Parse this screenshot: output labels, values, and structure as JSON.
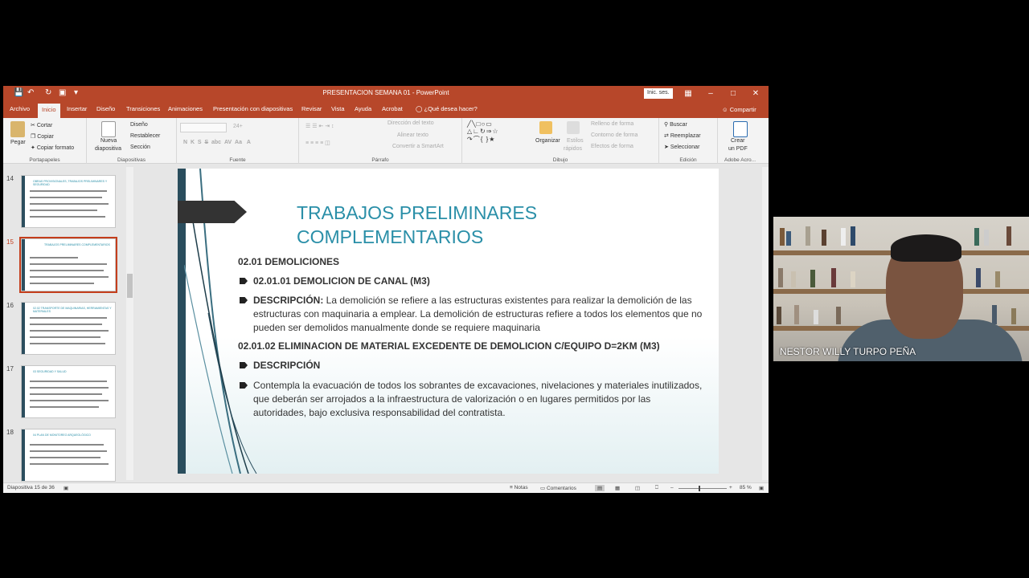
{
  "window": {
    "title": "PRESENTACION SEMANA 01  -  PowerPoint",
    "sign_in": "Inic. ses.",
    "controls": {
      "minimize": "–",
      "maximize": "□",
      "close": "✕"
    }
  },
  "tabs": [
    "Archivo",
    "Inicio",
    "Insertar",
    "Diseño",
    "Transiciones",
    "Animaciones",
    "Presentación con diapositivas",
    "Revisar",
    "Vista",
    "Ayuda",
    "Acrobat"
  ],
  "active_tab": "Inicio",
  "tell_me": "¿Qué desea hacer?",
  "share": "Compartir",
  "ribbon": {
    "clipboard": {
      "paste": "Pegar",
      "cut": "Cortar",
      "copy": "Copiar",
      "format_painter": "Copiar formato",
      "label": "Portapapeles"
    },
    "slides": {
      "new_slide_1": "Nueva",
      "new_slide_2": "diapositiva",
      "layout": "Diseño",
      "reset": "Restablecer",
      "section": "Sección",
      "label": "Diapositivas"
    },
    "font": {
      "size": "24+",
      "label": "Fuente"
    },
    "paragraph": {
      "text_direction": "Dirección del texto",
      "align_text": "Alinear texto",
      "smartart": "Convertir a SmartArt",
      "label": "Párrafo"
    },
    "drawing": {
      "arrange": "Organizar",
      "quick_styles_1": "Estilos",
      "quick_styles_2": "rápidos",
      "fill": "Relleno de forma",
      "outline": "Contorno de forma",
      "effects": "Efectos de forma",
      "label": "Dibujo"
    },
    "editing": {
      "find": "Buscar",
      "replace": "Reemplazar",
      "select": "Seleccionar",
      "label": "Edición"
    },
    "acrobat": {
      "create_pdf_1": "Crear",
      "create_pdf_2": "un PDF",
      "label": "Adobe Acro..."
    }
  },
  "thumbnails": [
    {
      "number": "14",
      "title": "OBRAS PROVISIONALES, TRABAJOS PRELIMINARES Y SEGURIDAD",
      "selected": false
    },
    {
      "number": "15",
      "title": "TRABAJOS PRELIMINARES COMPLEMENTARIOS",
      "selected": true
    },
    {
      "number": "16",
      "title": "02.02 TRANSPORTE DE MAQUINARIAS, HERRAMIENTAS Y MATERIALES",
      "selected": false
    },
    {
      "number": "17",
      "title": "03 SEGURIDAD Y SALUD",
      "selected": false
    },
    {
      "number": "18",
      "title": "04 PLAN DE MONITOREO ARQUEOLÓGICO",
      "selected": false
    }
  ],
  "slide": {
    "title_line1": "TRABAJOS PRELIMINARES",
    "title_line2": "COMPLEMENTARIOS",
    "h1": "02.01 DEMOLICIONES",
    "b1": "02.01.01 DEMOLICION DE CANAL (M3)",
    "b2_label": "DESCRIPCIÓN:",
    "b2_text": " La demolición se refiere a las estructuras existentes para realizar la demolición de las estructuras con maquinaria a emplear.  La demolición de estructuras refiere a todos los elementos que no pueden ser demolidos manualmente donde se requiere maquinaria",
    "h2": "02.01.02 ELIMINACION DE MATERIAL EXCEDENTE DE DEMOLICION C/EQUIPO D=2KM (M3)",
    "b3": "DESCRIPCIÓN",
    "b4": "Contempla la evacuación de todos los sobrantes de excavaciones, nivelaciones y materiales inutilizados, que deberán ser arrojados a la infraestructura de valorización o en lugares permitidos por las autoridades, bajo exclusiva responsabilidad del contratista."
  },
  "status": {
    "slide_count": "Diapositiva 15 de 36",
    "notes": "Notas",
    "comments": "Comentarios",
    "zoom": "85 %"
  },
  "webcam": {
    "participant_name": "NESTOR WILLY TURPO PEÑA"
  },
  "colors": {
    "ppt_accent": "#b7472a",
    "slide_title": "#2a8fa8",
    "slide_bar": "#2a4d5d"
  }
}
